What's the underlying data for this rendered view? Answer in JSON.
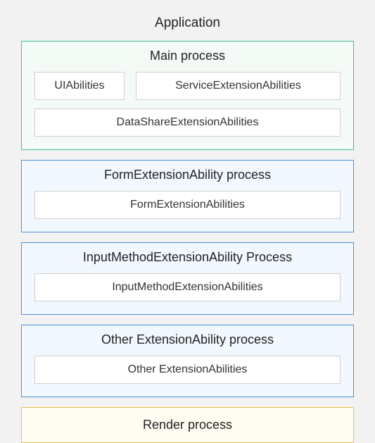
{
  "app_title": "Application",
  "main": {
    "title": "Main process",
    "ui": "UIAbilities",
    "service": "ServiceExtensionAbilities",
    "datashare": "DataShareExtensionAbilities"
  },
  "form": {
    "title": "FormExtensionAbility process",
    "ability": "FormExtensionAbilities"
  },
  "ime": {
    "title": "InputMethodExtensionAbility Process",
    "ability": "InputMethodExtensionAbilities"
  },
  "other": {
    "title": "Other ExtensionAbility process",
    "ability": "Other ExtensionAbilities"
  },
  "render": {
    "title": "Render process"
  }
}
